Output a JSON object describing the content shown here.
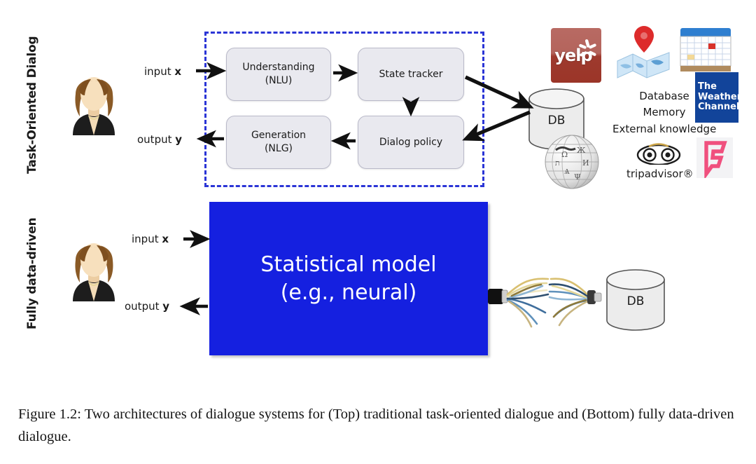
{
  "figure": {
    "caption": "Figure 1.2: Two architectures of dialogue systems for (Top) traditional task-oriented dialogue and (Bottom) fully data-driven dialogue."
  },
  "top_panel": {
    "side_label": "Task-Oriented Dialog",
    "input_label_prefix": "input ",
    "input_label_var": "x",
    "output_label_prefix": "output ",
    "output_label_var": "y",
    "modules": [
      {
        "id": "nlu",
        "line1": "Understanding",
        "line2": "(NLU)"
      },
      {
        "id": "state_tracker",
        "line1": "State tracker",
        "line2": ""
      },
      {
        "id": "nlg",
        "line1": "Generation",
        "line2": "(NLG)"
      },
      {
        "id": "dialog_policy",
        "line1": "Dialog policy",
        "line2": ""
      }
    ],
    "database_label": "DB",
    "knowledge_lines": [
      "Database",
      "Memory",
      "External knowledge"
    ],
    "logos": [
      {
        "name": "yelp-logo",
        "text": "yelp"
      },
      {
        "name": "map-pin-logo",
        "text": ""
      },
      {
        "name": "calendar-logo",
        "text": ""
      },
      {
        "name": "weather-channel-logo",
        "line1": "The",
        "line2": "Weather",
        "line3": "Channel"
      },
      {
        "name": "wikipedia-globe-logo",
        "text": ""
      },
      {
        "name": "tripadvisor-logo",
        "text": "tripadvisor®"
      },
      {
        "name": "foursquare-logo",
        "text": ""
      }
    ]
  },
  "bottom_panel": {
    "side_label": "Fully data-driven",
    "input_label_prefix": "input ",
    "input_label_var": "x",
    "output_label_prefix": "output ",
    "output_label_var": "y",
    "model_line1": "Statistical model",
    "model_line2": "(e.g., neural)",
    "database_label": "DB"
  },
  "colors": {
    "model_blue": "#1520e0",
    "dashed_border_blue": "#2b35d6",
    "module_fill": "#e9e9ef",
    "yelp_red": "#9b3528",
    "weather_blue": "#12449a",
    "foursquare_pink": "#f0507e"
  }
}
